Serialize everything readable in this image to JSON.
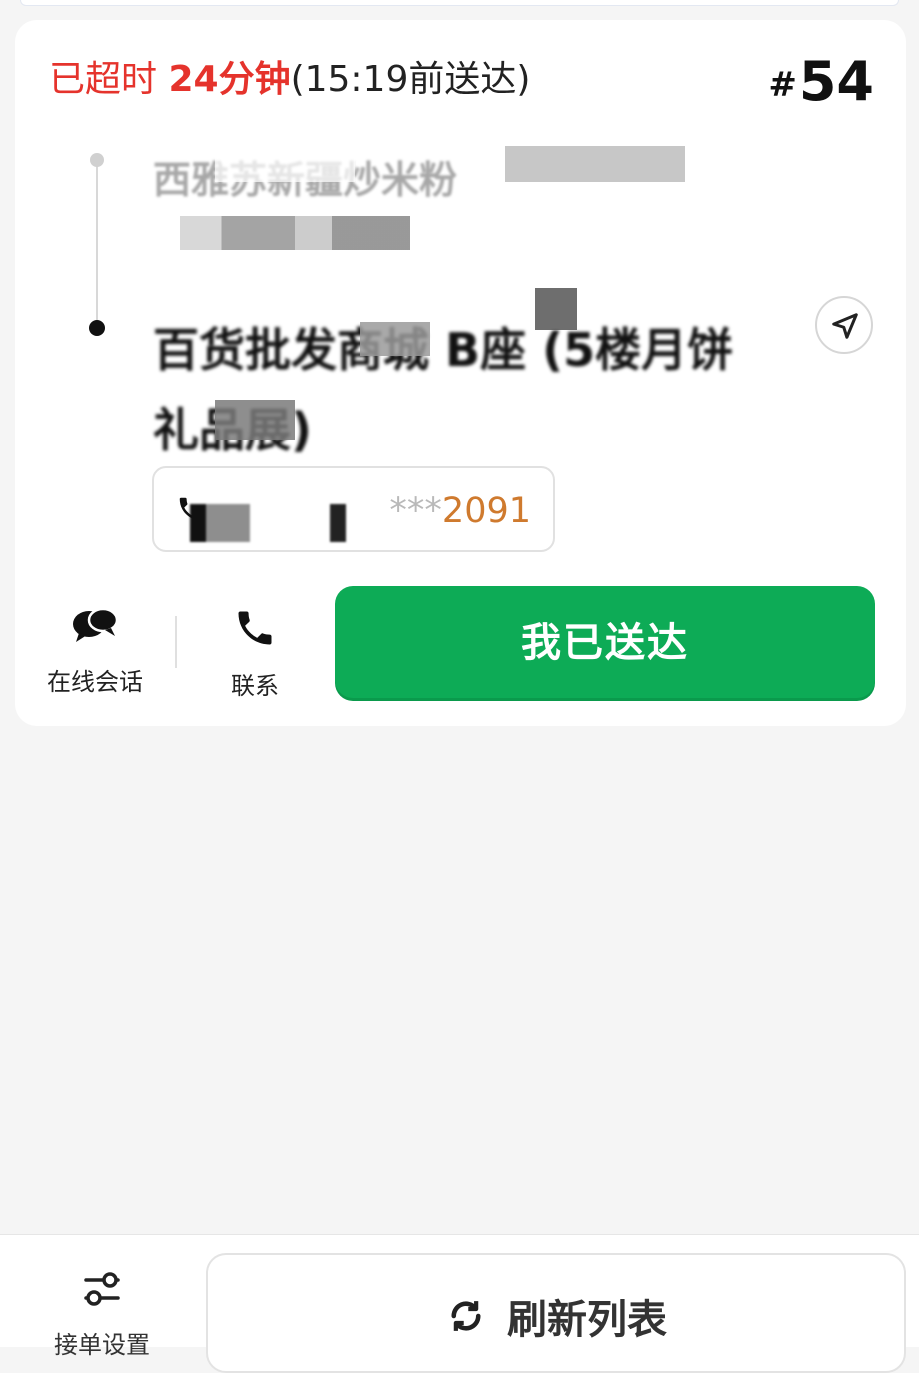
{
  "order": {
    "status_prefix": "已超时",
    "overdue_minutes": "24分钟",
    "deadline": "(15:19前送达)",
    "number_hash": "#",
    "number": "54"
  },
  "route": {
    "pickup_name": "西雅苏新疆炒米粉",
    "destination_name": "百货批发商城 B座 (5楼月饼礼品展)"
  },
  "phone": {
    "masked_prefix": "***",
    "last_digits": "2091"
  },
  "actions": {
    "chat_label": "在线会话",
    "contact_label": "联系",
    "deliver_label": "我已送达"
  },
  "bottom": {
    "settings_label": "接单设置",
    "refresh_label": "刷新列表"
  },
  "colors": {
    "overdue_red": "#e5332c",
    "deliver_green": "#0dab56",
    "phone_orange": "#cf7a2e"
  },
  "icons": {
    "navigation": "navigation-arrow-icon",
    "chat": "chat-bubbles-icon",
    "contact": "phone-icon",
    "settings": "slider-settings-icon",
    "refresh": "refresh-icon"
  }
}
